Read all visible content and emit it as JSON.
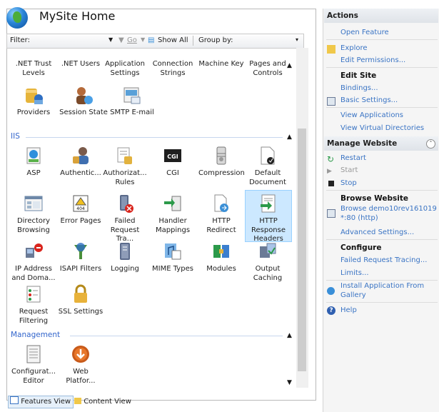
{
  "header": {
    "title": "MySite Home"
  },
  "filter_bar": {
    "filter_label": "Filter:",
    "go_label": "Go",
    "show_all_label": "Show All",
    "group_by_label": "Group by:"
  },
  "partial_row": [
    {
      "label": ".NET Trust Levels"
    },
    {
      "label": ".NET Users"
    },
    {
      "label": "Application Settings"
    },
    {
      "label": "Connection Strings"
    },
    {
      "label": "Machine Key"
    },
    {
      "label": "Pages and Controls"
    }
  ],
  "aspnet_row2": [
    {
      "label": "Providers"
    },
    {
      "label": "Session State"
    },
    {
      "label": "SMTP E-mail"
    }
  ],
  "iis": {
    "group_label": "IIS",
    "items": [
      {
        "label": "ASP"
      },
      {
        "label": "Authentic..."
      },
      {
        "label": "Authorizat... Rules"
      },
      {
        "label": "CGI"
      },
      {
        "label": "Compression"
      },
      {
        "label": "Default Document"
      },
      {
        "label": "Directory Browsing"
      },
      {
        "label": "Error Pages"
      },
      {
        "label": "Failed Request Tra..."
      },
      {
        "label": "Handler Mappings"
      },
      {
        "label": "HTTP Redirect"
      },
      {
        "label": "HTTP Response Headers"
      },
      {
        "label": "IP Address and Doma..."
      },
      {
        "label": "ISAPI Filters"
      },
      {
        "label": "Logging"
      },
      {
        "label": "MIME Types"
      },
      {
        "label": "Modules"
      },
      {
        "label": "Output Caching"
      },
      {
        "label": "Request Filtering"
      },
      {
        "label": "SSL Settings"
      }
    ]
  },
  "management": {
    "group_label": "Management",
    "items": [
      {
        "label": "Configurat... Editor"
      },
      {
        "label": "Web Platfor..."
      }
    ]
  },
  "bottom": {
    "features_view": "Features View",
    "content_view": "Content View"
  },
  "actions": {
    "title": "Actions",
    "open_feature": "Open Feature",
    "explore": "Explore",
    "edit_permissions": "Edit Permissions...",
    "edit_site": "Edit Site",
    "bindings": "Bindings...",
    "basic_settings": "Basic Settings...",
    "view_applications": "View Applications",
    "view_virtual_directories": "View Virtual Directories",
    "manage_website": "Manage Website",
    "restart": "Restart",
    "start": "Start",
    "stop": "Stop",
    "browse_website": "Browse Website",
    "browse_link_line1": "Browse demo10rev161019 on",
    "browse_link_line2": "*:80 (http)",
    "advanced_settings": "Advanced Settings...",
    "configure": "Configure",
    "failed_request_tracing": "Failed Request Tracing...",
    "limits": "Limits...",
    "install_app_line1": "Install Application From",
    "install_app_line2": "Gallery",
    "help": "Help"
  },
  "colors": {
    "link": "#3a74c4",
    "group_header": "#3366cc",
    "selection": "#cce8ff"
  }
}
